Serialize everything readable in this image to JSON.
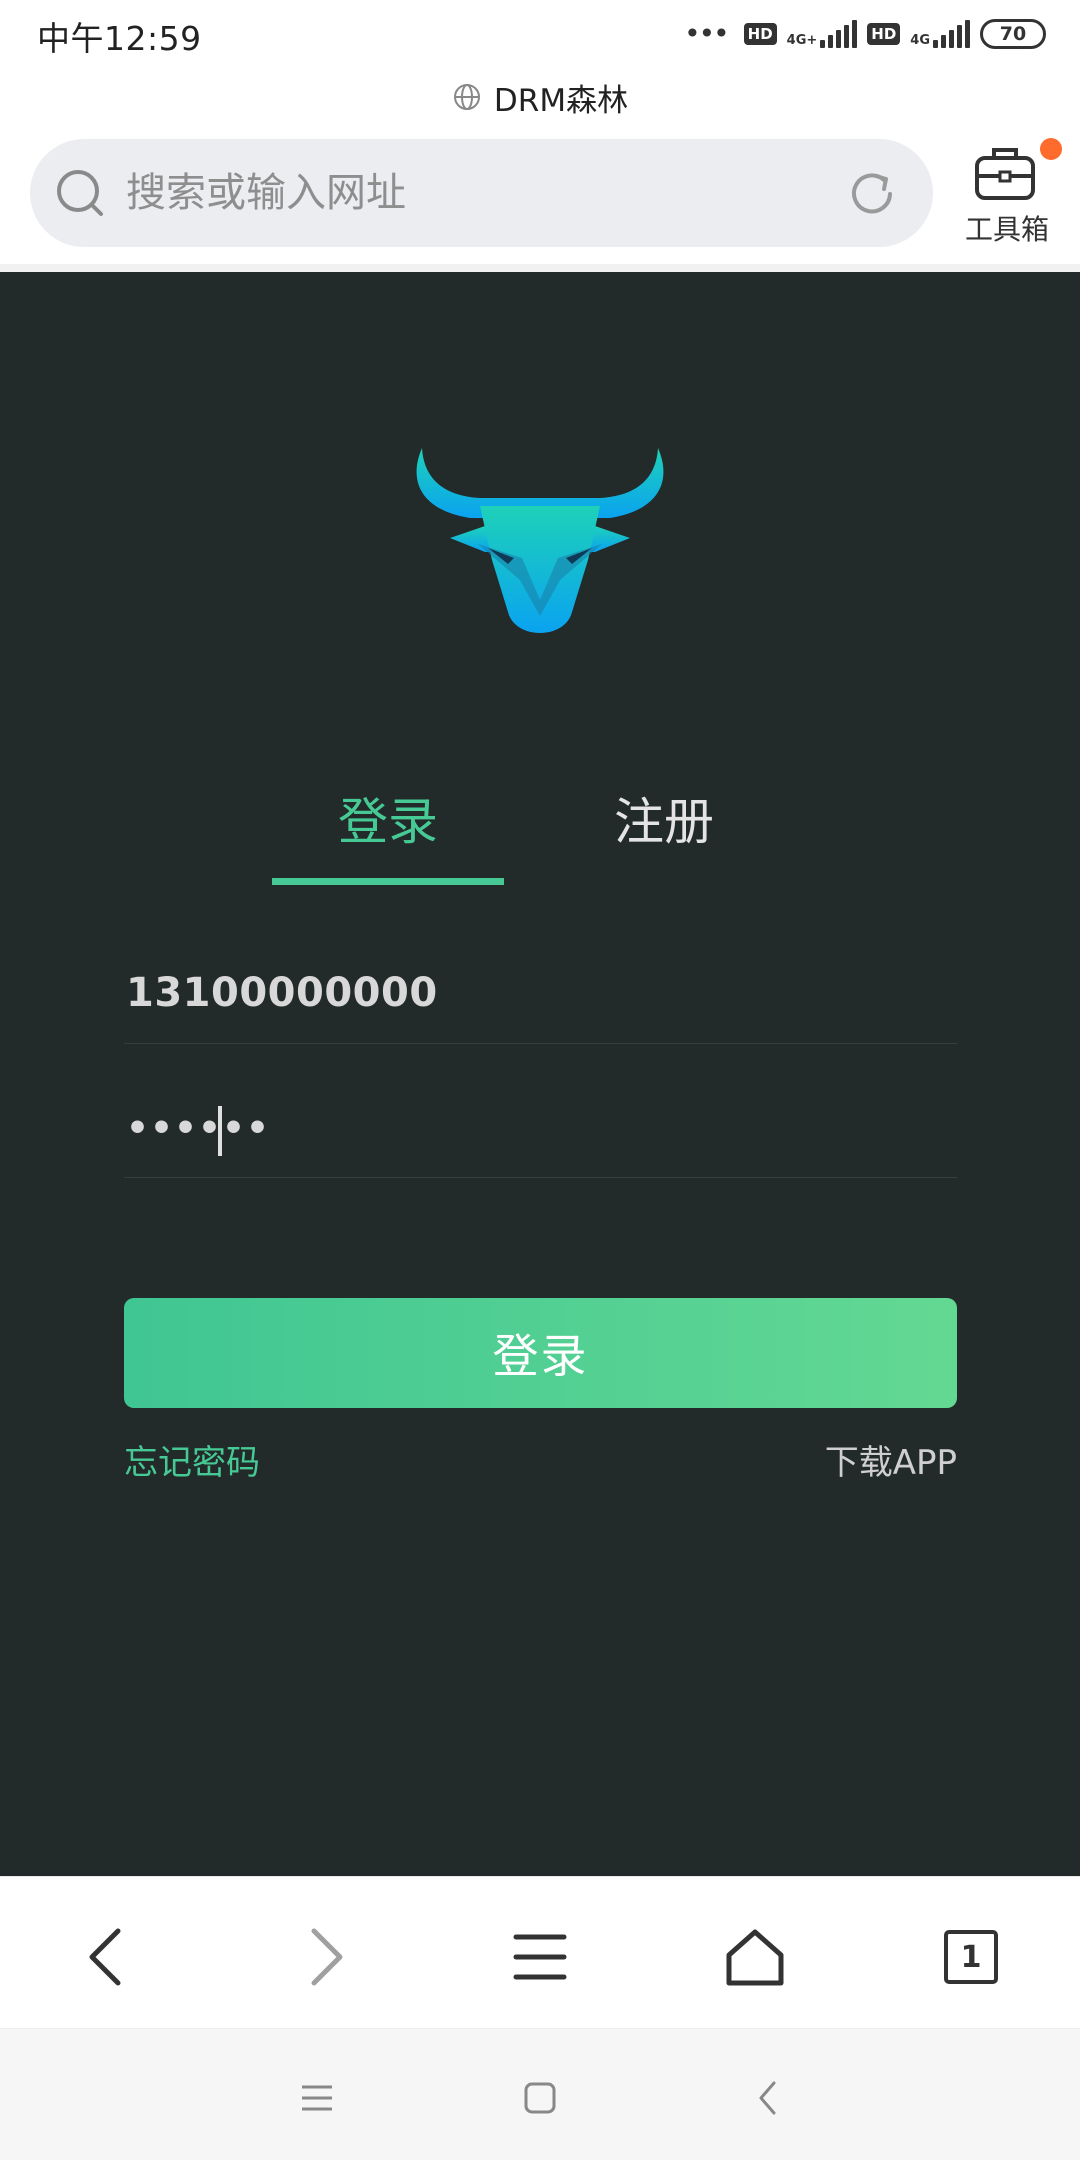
{
  "status_bar": {
    "time": "中午12:59",
    "network_1": "4G+",
    "network_2": "4G",
    "hd": "HD",
    "battery": "70"
  },
  "page": {
    "title": "DRM森林"
  },
  "search": {
    "placeholder": "搜索或输入网址",
    "value": ""
  },
  "toolbox": {
    "label": "工具箱",
    "has_notification": true,
    "notification_color": "#ff6b2c"
  },
  "auth": {
    "tabs": [
      {
        "label": "登录",
        "active": true
      },
      {
        "label": "注册",
        "active": false
      }
    ],
    "phone_value": "13100000000",
    "password_value": "••••••",
    "login_button": "登录",
    "forgot_password": "忘记密码",
    "download_app": "下载APP",
    "accent_color": "#46c994",
    "background_color": "#222a2a"
  },
  "browser_nav": {
    "items": [
      "back-icon",
      "forward-icon",
      "menu-icon",
      "home-icon",
      "tabs-icon"
    ],
    "tab_count": "1"
  },
  "system_nav": {
    "items": [
      "recents-icon",
      "home-icon",
      "back-icon"
    ]
  }
}
